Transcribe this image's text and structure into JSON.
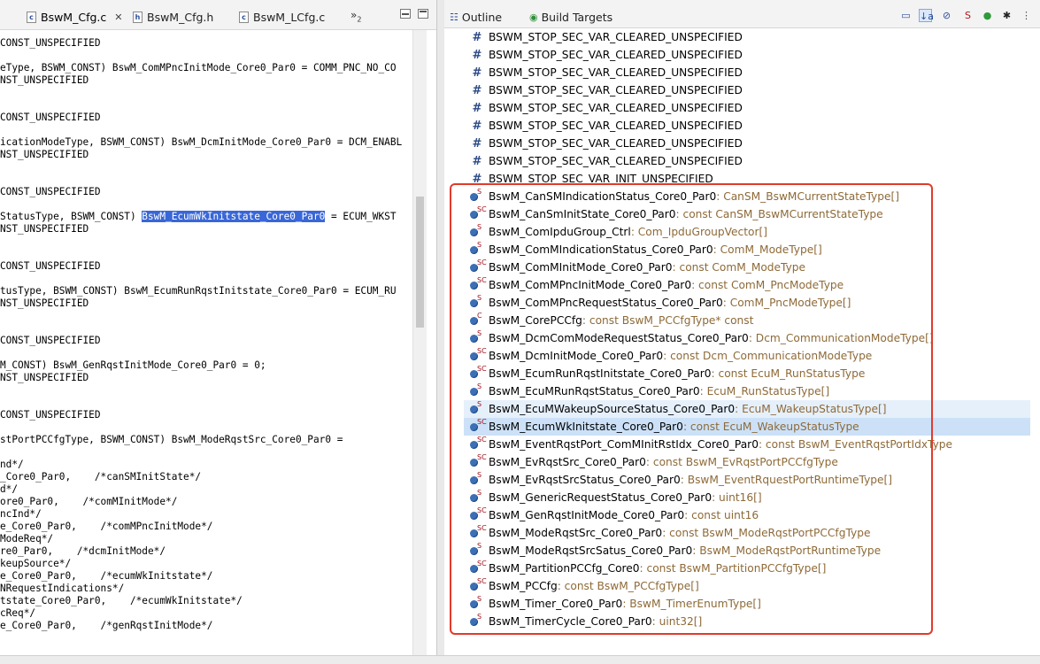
{
  "editor": {
    "tabs": [
      {
        "label": "BswM_Cfg.c",
        "icon": "c-file-icon",
        "active": true
      },
      {
        "label": "BswM_Cfg.h",
        "icon": "h-file-icon"
      },
      {
        "label": "BswM_LCfg.c",
        "icon": "c-file-icon"
      }
    ],
    "overflow_label": "»",
    "overflow_count": "2",
    "lines": [
      "CONST_UNSPECIFIED",
      "",
      "eType, BSWM_CONST) BswM_ComMPncInitMode_Core0_Par0 = COMM_PNC_NO_CO",
      "NST_UNSPECIFIED",
      "",
      "",
      "CONST_UNSPECIFIED",
      "",
      "icationModeType, BSWM_CONST) BswM_DcmInitMode_Core0_Par0 = DCM_ENABL",
      "NST_UNSPECIFIED",
      "",
      "",
      "CONST_UNSPECIFIED",
      "",
      "",
      "NST_UNSPECIFIED",
      "",
      "",
      "CONST_UNSPECIFIED",
      "",
      "tusType, BSWM_CONST) BswM_EcumRunRqstInitstate_Core0_Par0 = ECUM_RU",
      "NST_UNSPECIFIED",
      "",
      "",
      "CONST_UNSPECIFIED",
      "",
      "M_CONST) BswM_GenRqstInitMode_Core0_Par0 = 0;",
      "NST_UNSPECIFIED",
      "",
      "",
      "CONST_UNSPECIFIED",
      "",
      "stPortPCCfgType, BSWM_CONST) BswM_ModeRqstSrc_Core0_Par0 =",
      "",
      "nd*/",
      "_Core0_Par0,    /*canSMInitState*/",
      "d*/",
      "ore0_Par0,    /*comMInitMode*/",
      "ncInd*/",
      "e_Core0_Par0,    /*comMPncInitMode*/",
      "ModeReq*/",
      "re0_Par0,    /*dcmInitMode*/",
      "keupSource*/",
      "e_Core0_Par0,    /*ecumWkInitstate*/",
      "NRequestIndications*/",
      "tstate_Core0_Par0,    /*ecumWkInitstate*/",
      "cReq*/",
      "e_Core0_Par0,    /*genRqstInitMode*/"
    ],
    "sel_line": {
      "prefix": "StatusType, BSWM_CONST) ",
      "highlight": "BswM_EcumWkInitstate_Core0_Par0",
      "suffix": " = ECUM_WKST"
    }
  },
  "outline": {
    "tabs": [
      {
        "label": "Outline",
        "icon": "outline-icon",
        "active": true
      },
      {
        "label": "Build Targets",
        "icon": "build-targets-icon"
      }
    ],
    "toolbar": [
      {
        "name": "collapse-all-icon",
        "glyph": "▭"
      },
      {
        "name": "sort-az-icon",
        "glyph": "↓a"
      },
      {
        "name": "hide-fields-icon",
        "glyph": "⊘"
      },
      {
        "name": "hide-static-icon",
        "glyph": "S"
      },
      {
        "name": "hide-non-public-icon",
        "glyph": "●"
      },
      {
        "name": "hide-includes-icon",
        "glyph": "✱"
      }
    ],
    "macros": [
      "BSWM_STOP_SEC_VAR_CLEARED_UNSPECIFIED",
      "BSWM_STOP_SEC_VAR_CLEARED_UNSPECIFIED",
      "BSWM_STOP_SEC_VAR_CLEARED_UNSPECIFIED",
      "BSWM_STOP_SEC_VAR_CLEARED_UNSPECIFIED",
      "BSWM_STOP_SEC_VAR_CLEARED_UNSPECIFIED",
      "BSWM_STOP_SEC_VAR_CLEARED_UNSPECIFIED",
      "BSWM_STOP_SEC_VAR_CLEARED_UNSPECIFIED",
      "BSWM_STOP_SEC_VAR_CLEARED_UNSPECIFIED",
      "BSWM_STOP_SEC_VAR_INIT_UNSPECIFIED"
    ],
    "items": [
      {
        "name": "BswM_CanSMIndicationStatus_Core0_Par0",
        "type": " : CanSM_BswMCurrentStateType[]",
        "ov": "S"
      },
      {
        "name": "BswM_CanSmInitState_Core0_Par0",
        "type": " : const CanSM_BswMCurrentStateType",
        "ov": "SC"
      },
      {
        "name": "BswM_ComIpduGroup_Ctrl",
        "type": " : Com_IpduGroupVector[]",
        "ov": "S"
      },
      {
        "name": "BswM_ComMIndicationStatus_Core0_Par0",
        "type": " : ComM_ModeType[]",
        "ov": "S"
      },
      {
        "name": "BswM_ComMInitMode_Core0_Par0",
        "type": " : const ComM_ModeType",
        "ov": "SC"
      },
      {
        "name": "BswM_ComMPncInitMode_Core0_Par0",
        "type": " : const ComM_PncModeType",
        "ov": "SC"
      },
      {
        "name": "BswM_ComMPncRequestStatus_Core0_Par0",
        "type": " : ComM_PncModeType[]",
        "ov": "S"
      },
      {
        "name": "BswM_CorePCCfg",
        "type": " : const BswM_PCCfgType* const",
        "ov": "C"
      },
      {
        "name": "BswM_DcmComModeRequestStatus_Core0_Par0",
        "type": " : Dcm_CommunicationModeType[]",
        "ov": "S"
      },
      {
        "name": "BswM_DcmInitMode_Core0_Par0",
        "type": " : const Dcm_CommunicationModeType",
        "ov": "SC"
      },
      {
        "name": "BswM_EcumRunRqstInitstate_Core0_Par0",
        "type": " : const EcuM_RunStatusType",
        "ov": "SC"
      },
      {
        "name": "BswM_EcuMRunRqstStatus_Core0_Par0",
        "type": " : EcuM_RunStatusType[]",
        "ov": "S"
      },
      {
        "name": "BswM_EcuMWakeupSourceStatus_Core0_Par0",
        "type": " : EcuM_WakeupStatusType[]",
        "ov": "S"
      },
      {
        "name": "BswM_EcumWkInitstate_Core0_Par0",
        "type": " : const EcuM_WakeupStatusType",
        "ov": "SC"
      },
      {
        "name": "BswM_EventRqstPort_ComMInitRstIdx_Core0_Par0",
        "type": " : const BswM_EventRqstPortIdxType",
        "ov": "SC"
      },
      {
        "name": "BswM_EvRqstSrc_Core0_Par0",
        "type": " : const BswM_EvRqstPortPCCfgType",
        "ov": "SC"
      },
      {
        "name": "BswM_EvRqstSrcStatus_Core0_Par0",
        "type": " : BswM_EventRquestPortRuntimeType[]",
        "ov": "S"
      },
      {
        "name": "BswM_GenericRequestStatus_Core0_Par0",
        "type": " : uint16[]",
        "ov": "S"
      },
      {
        "name": "BswM_GenRqstInitMode_Core0_Par0",
        "type": " : const uint16",
        "ov": "SC"
      },
      {
        "name": "BswM_ModeRqstSrc_Core0_Par0",
        "type": " : const BswM_ModeRqstPortPCCfgType",
        "ov": "SC"
      },
      {
        "name": "BswM_ModeRqstSrcSatus_Core0_Par0",
        "type": " : BswM_ModeRqstPortRuntimeType",
        "ov": "S"
      },
      {
        "name": "BswM_PartitionPCCfg_Core0",
        "type": " : const BswM_PartitionPCCfgType[]",
        "ov": "SC"
      },
      {
        "name": "BswM_PCCfg",
        "type": " : const BswM_PCCfgType[]",
        "ov": "SC"
      },
      {
        "name": "BswM_Timer_Core0_Par0",
        "type": " : BswM_TimerEnumType[]",
        "ov": "S"
      },
      {
        "name": "BswM_TimerCycle_Core0_Par0",
        "type": " : uint32[]",
        "ov": "S"
      }
    ]
  },
  "colors": {
    "highlight": "#3967d8",
    "type_text": "#8e6a38",
    "red_box": "#e23a2a",
    "selected_row": "#cce1f8"
  }
}
